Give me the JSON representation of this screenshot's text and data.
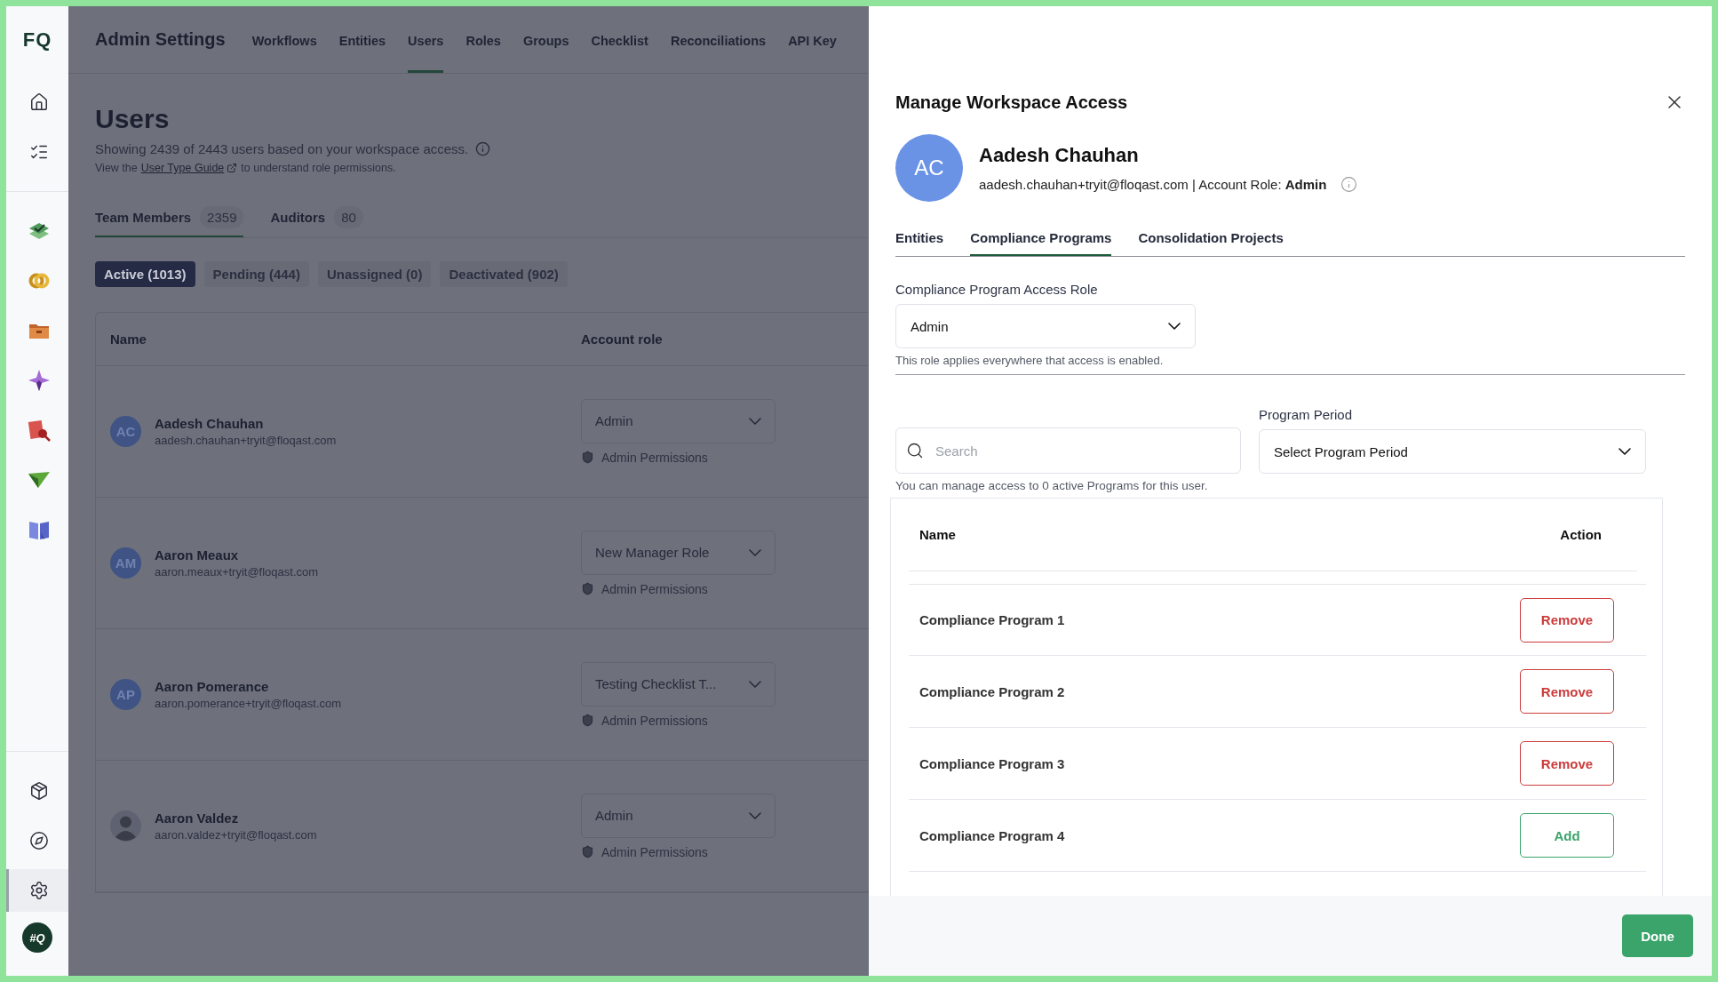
{
  "sidebar": {
    "logo": "FQ",
    "top_items": [
      {
        "kind": "home",
        "selected": false
      },
      {
        "kind": "tasks",
        "selected": false
      }
    ],
    "app_items": [
      {
        "kind": "layers-check",
        "selected": false
      },
      {
        "kind": "rings",
        "selected": false
      },
      {
        "kind": "folder",
        "selected": false
      },
      {
        "kind": "sparkle",
        "selected": false
      },
      {
        "kind": "doc-search",
        "selected": false
      },
      {
        "kind": "plane",
        "selected": false
      },
      {
        "kind": "book",
        "selected": false
      }
    ],
    "bottom_items": [
      {
        "kind": "learn",
        "selected": false
      },
      {
        "kind": "compass",
        "selected": false
      },
      {
        "kind": "settings",
        "selected": true
      }
    ],
    "avatar": "#Q"
  },
  "header": {
    "title": "Admin Settings",
    "tabs": [
      {
        "label": "Workflows",
        "selected": false
      },
      {
        "label": "Entities",
        "selected": false
      },
      {
        "label": "Users",
        "selected": true
      },
      {
        "label": "Roles",
        "selected": false
      },
      {
        "label": "Groups",
        "selected": false
      },
      {
        "label": "Checklist",
        "selected": false
      },
      {
        "label": "Reconciliations",
        "selected": false
      },
      {
        "label": "API Key",
        "selected": false
      }
    ]
  },
  "page": {
    "title": "Users",
    "subtitle": "Showing 2439 of 2443 users based on your workspace access.",
    "guide_prefix": "View the",
    "guide_link": "User Type Guide",
    "guide_suffix": "to understand role permissions.",
    "user_tabs": [
      {
        "label": "Team Members",
        "count": "2359",
        "selected": true
      },
      {
        "label": "Auditors",
        "count": "80",
        "selected": false
      }
    ],
    "filters": [
      {
        "label": "Active (1013)",
        "selected": true
      },
      {
        "label": "Pending (444)",
        "selected": false
      },
      {
        "label": "Unassigned (0)",
        "selected": false
      },
      {
        "label": "Deactivated (902)",
        "selected": false
      }
    ],
    "table": {
      "columns": [
        "Name",
        "Account role"
      ],
      "rows": [
        {
          "kind": "initials",
          "initials": "AC",
          "name": "Aadesh Chauhan",
          "email": "aadesh.chauhan+tryit@floqast.com",
          "role": "Admin",
          "permissions": "Admin Permissions"
        },
        {
          "kind": "initials",
          "initials": "AM",
          "name": "Aaron Meaux",
          "email": "aaron.meaux+tryit@floqast.com",
          "role": "New Manager Role",
          "permissions": "Admin Permissions"
        },
        {
          "kind": "initials",
          "initials": "AP",
          "name": "Aaron Pomerance",
          "email": "aaron.pomerance+tryit@floqast.com",
          "role": "Testing Checklist T...",
          "permissions": "Admin Permissions"
        },
        {
          "kind": "photo",
          "name": "Aaron Valdez",
          "email": "aaron.valdez+tryit@floqast.com",
          "role": "Admin",
          "permissions": "Admin Permissions"
        }
      ]
    }
  },
  "drawer": {
    "title": "Manage Workspace Access",
    "user": {
      "initials": "AC",
      "name": "Aadesh Chauhan",
      "details": "aadesh.chauhan+tryit@floqast.com | Account Role: **Admin**"
    },
    "tabs": [
      {
        "label": "Entities",
        "selected": false
      },
      {
        "label": "Compliance Programs",
        "selected": true
      },
      {
        "label": "Consolidation Projects",
        "selected": false
      }
    ],
    "access_role": {
      "label": "Compliance Program Access Role",
      "value": "Admin",
      "hint": "This role applies everywhere that access is enabled."
    },
    "search": {
      "placeholder": "Search"
    },
    "period": {
      "label": "Program Period",
      "value": "Select Program Period"
    },
    "note": "You can manage access to 0 active Programs for this user.",
    "programs": {
      "columns": [
        "Name",
        "Action"
      ],
      "rows": [
        {
          "name": "Compliance Program 1",
          "action": "Remove",
          "kind": "remove"
        },
        {
          "name": "Compliance Program 2",
          "action": "Remove",
          "kind": "remove"
        },
        {
          "name": "Compliance Program 3",
          "action": "Remove",
          "kind": "remove"
        },
        {
          "name": "Compliance Program 4",
          "action": "Add",
          "kind": "add"
        }
      ]
    },
    "done": "Done"
  }
}
